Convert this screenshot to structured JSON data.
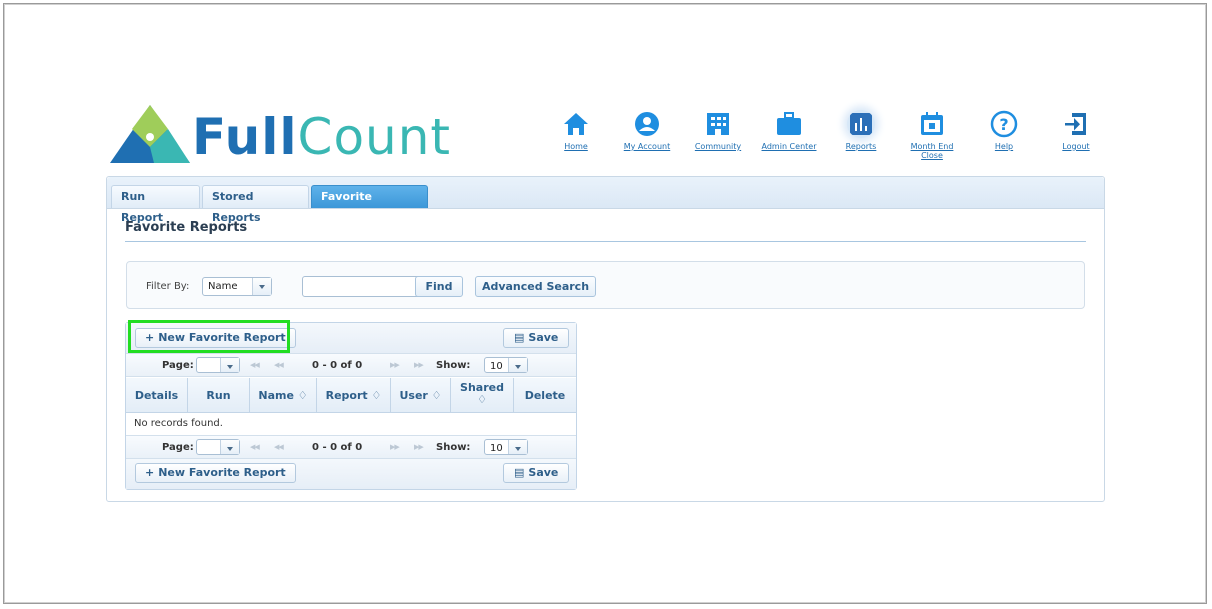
{
  "logo": {
    "part1": "Full",
    "part2": "Count"
  },
  "nav": [
    {
      "key": "home",
      "label": "Home",
      "icon": "home-icon"
    },
    {
      "key": "my-account",
      "label": "My Account",
      "icon": "user-circle-icon"
    },
    {
      "key": "community",
      "label": "Community",
      "icon": "building-icon"
    },
    {
      "key": "admin-center",
      "label": "Admin Center",
      "icon": "briefcase-icon"
    },
    {
      "key": "reports",
      "label": "Reports",
      "icon": "bar-chart-icon",
      "active": true
    },
    {
      "key": "month-end-close",
      "label": "Month End",
      "label2": "Close",
      "icon": "calendar-icon"
    },
    {
      "key": "help",
      "label": "Help",
      "icon": "question-icon"
    },
    {
      "key": "logout",
      "label": "Logout",
      "icon": "logout-icon"
    }
  ],
  "tabs": {
    "run": "Run Report",
    "stored": "Stored Reports",
    "favorite": "Favorite Reports"
  },
  "section": {
    "title": "Favorite Reports"
  },
  "filter": {
    "label": "Filter By:",
    "select_value": "Name",
    "input_value": "",
    "find_label": "Find",
    "advanced_label": "Advanced Search"
  },
  "grid": {
    "new_label": "New Favorite Report",
    "save_label": "Save",
    "page_label": "Page:",
    "page_value": "",
    "pager_info": "0 - 0 of 0",
    "show_label": "Show:",
    "show_value": "10",
    "columns": {
      "details": "Details",
      "run": "Run",
      "name": "Name ♢",
      "report": "Report ♢",
      "user": "User ♢",
      "shared": "Shared",
      "shared_sort": "♢",
      "delete": "Delete"
    },
    "empty_text": "No records found."
  },
  "colors": {
    "brand_blue": "#1f6fb2",
    "brand_teal": "#3ab7b3",
    "tab_active": "#3c97d8",
    "highlight": "#22dd22"
  }
}
